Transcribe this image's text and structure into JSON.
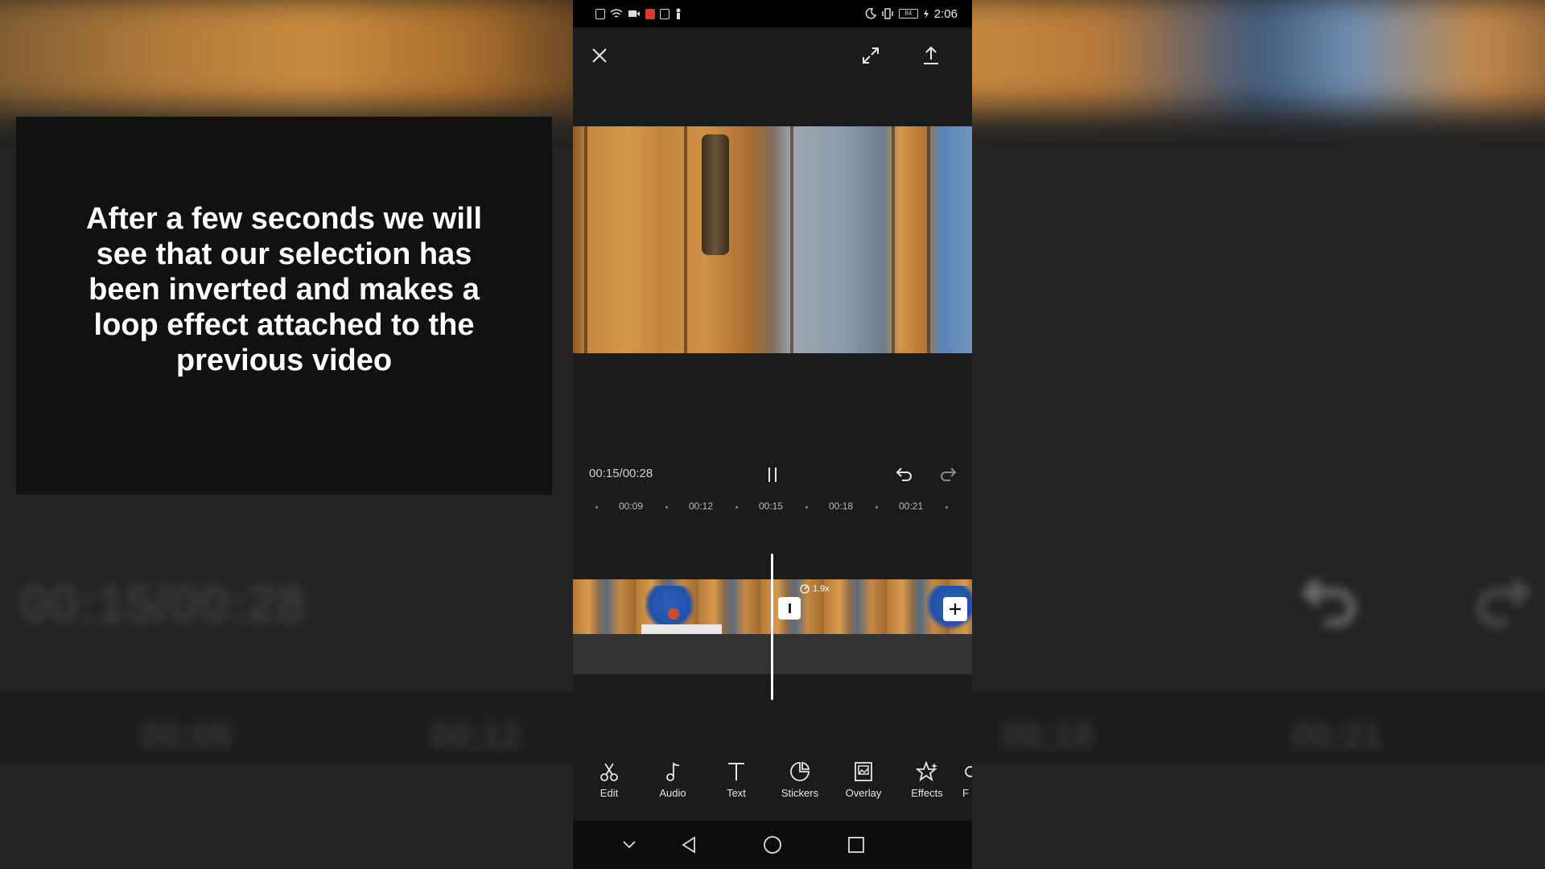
{
  "caption": {
    "text": "After a few seconds we will see that our selection has been inverted and makes a loop effect attached to the previous video"
  },
  "status_bar": {
    "time": "2:06",
    "battery": "84"
  },
  "player": {
    "timecode": "00:15/00:28"
  },
  "timeline": {
    "ruler": [
      "00:09",
      "00:12",
      "00:15",
      "00:18",
      "00:21"
    ],
    "speed_badge": "1.9x"
  },
  "toolbar": {
    "items": [
      {
        "label": "Edit",
        "icon": "scissors-icon"
      },
      {
        "label": "Audio",
        "icon": "music-note-icon"
      },
      {
        "label": "Text",
        "icon": "text-icon"
      },
      {
        "label": "Stickers",
        "icon": "sticker-icon"
      },
      {
        "label": "Overlay",
        "icon": "overlay-icon"
      },
      {
        "label": "Effects",
        "icon": "effects-star-icon"
      },
      {
        "label": "F",
        "icon": "filter-icon"
      }
    ]
  },
  "background": {
    "ghost_left": "00:15/00:28",
    "ghost_ruler": [
      "00:09",
      "00:12",
      "00:18",
      "00:21"
    ]
  },
  "colors": {
    "accent": "#ffffff",
    "panel": "#1b1b1b",
    "status_red": "#e0392b"
  }
}
